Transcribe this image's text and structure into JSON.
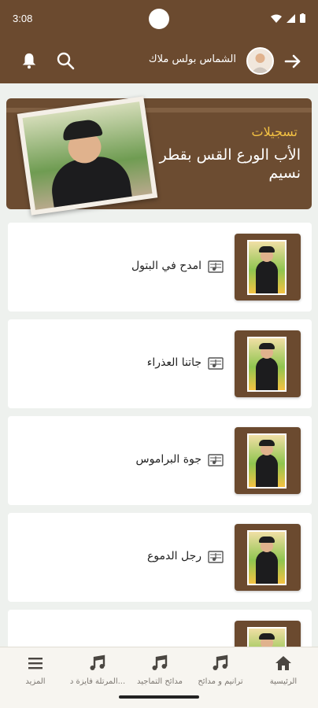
{
  "status": {
    "time": "3:08"
  },
  "header": {
    "user_name": "الشماس بولس ملاك"
  },
  "banner": {
    "subtitle": "تسجيلات",
    "title": "الأب الورع القس بقطر نسيم"
  },
  "recordings": [
    {
      "title": "امدح في البتول"
    },
    {
      "title": "جاتنا العذراء"
    },
    {
      "title": "جوة البراموس"
    },
    {
      "title": "رجل الدموع"
    },
    {
      "title": ""
    }
  ],
  "bottom_nav": [
    {
      "label": "الرئيسية",
      "icon": "home-icon",
      "active": true
    },
    {
      "label": "ترانيم و مدائح",
      "icon": "music-note-icon"
    },
    {
      "label": "مدائح التماجيد",
      "icon": "music-note-icon"
    },
    {
      "label": "المرتلة فايزة د...",
      "icon": "music-note-icon"
    },
    {
      "label": "المزيد",
      "icon": "menu-icon"
    }
  ],
  "colors": {
    "brown": "#6b4a2f",
    "gold": "#f4c243",
    "background": "#eef1ee"
  }
}
